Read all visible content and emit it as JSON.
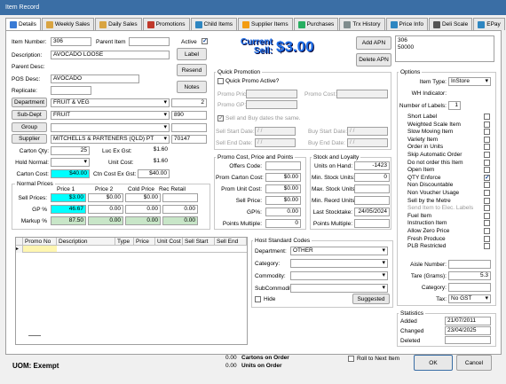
{
  "window": {
    "title": "Item Record"
  },
  "tabs": [
    {
      "label": "Details",
      "color": "#3a7bd5"
    },
    {
      "label": "Weekly Sales",
      "color": "#d9a441"
    },
    {
      "label": "Daily Sales",
      "color": "#d9a441"
    },
    {
      "label": "Promotions",
      "color": "#c0392b"
    },
    {
      "label": "Child Items",
      "color": "#2e86c1"
    },
    {
      "label": "Supplier Items",
      "color": "#f39c12"
    },
    {
      "label": "Purchases",
      "color": "#27ae60"
    },
    {
      "label": "Trx History",
      "color": "#7f8c8d"
    },
    {
      "label": "Price Info",
      "color": "#2e86c1"
    },
    {
      "label": "Deli Scale",
      "color": "#555555"
    },
    {
      "label": "EPay",
      "color": "#2e86c1"
    }
  ],
  "item": {
    "item_number_label": "Item Number:",
    "item_number": "306",
    "parent_item_label": "Parent Item",
    "parent_item": "",
    "active_label": "Active",
    "description_label": "Description:",
    "description": "AVOCADO  LOOSE",
    "parent_desc_label": "Parent Desc:",
    "pos_desc_label": "POS Desc:",
    "pos_desc": "AVOCADO",
    "replicate_label": "Replicate:",
    "label_btn": "Label",
    "resend_btn": "Resend",
    "notes_btn": "Notes",
    "current_sell_line1": "Current",
    "current_sell_line2": "Sell:",
    "current_sell_value": "$3.00",
    "add_apn_btn": "Add APN",
    "delete_apn_btn": "Delete APN",
    "apns": [
      "306",
      "50000"
    ]
  },
  "classification": {
    "department_btn": "Department",
    "department": "FRUIT & VEG",
    "department_code": "2",
    "subdept_btn": "Sub-Dept",
    "subdept": "FRUIT",
    "subdept_code": "890",
    "group_btn": "Group",
    "group": "",
    "supplier_btn": "Supplier",
    "supplier": "MITCHELLS & PARTENERS (QLD) PT",
    "supplier_code": "70147"
  },
  "costs": {
    "carton_qty_label": "Carton Qty:",
    "carton_qty": "25",
    "luc_label": "Luc Ex Gst:",
    "luc": "$1.60",
    "hold_normal_label": "Hold Normal:",
    "unit_cost_label": "Unit Cost:",
    "unit_cost": "$1.60",
    "carton_cost_label": "Carton Cost:",
    "carton_cost": "$40.00",
    "ctn_cost_label": "Ctn Cost Ex Gst:",
    "ctn_cost": "$40.00"
  },
  "normal_prices": {
    "title": "Normal Prices",
    "headers": [
      "Price 1",
      "Price 2",
      "Cold Price",
      "Rec Retail"
    ],
    "rows": [
      {
        "label": "Sell Prices:",
        "values": [
          "$3.00",
          "$0.00",
          "$0.00",
          ""
        ]
      },
      {
        "label": "GP %",
        "values": [
          "46.67",
          "0.00",
          "0.00",
          "0.00"
        ]
      },
      {
        "label": "Markup %",
        "values": [
          "87.50",
          "0.00",
          "0.00",
          "0.00"
        ]
      }
    ]
  },
  "quick_promo": {
    "title": "Quick Promotion",
    "active_label": "Quick Promo Active?",
    "promo_price_label": "Promo Price:",
    "promo_cost_label": "Promo Cost:",
    "promo_gp_label": "Promo GP:",
    "same_dates_label": "Sell and Buy dates the same.",
    "sell_start_label": "Sell Start Date:",
    "sell_start": "/ /",
    "buy_start_label": "Buy Start Date:",
    "buy_start": "/ /",
    "sell_end_label": "Sell End Date:",
    "sell_end": "/ /",
    "buy_end_label": "Buy End Date:",
    "buy_end": "/ /"
  },
  "promo_cost": {
    "title": "Promo Cost, Price and Points",
    "rows": [
      {
        "label": "Offers Code:",
        "value": ""
      },
      {
        "label": "Prom Carton Cost:",
        "value": "$0.00"
      },
      {
        "label": "Prom Unit Cost:",
        "value": "$0.00"
      },
      {
        "label": "Sell Price:",
        "value": "$0.00"
      },
      {
        "label": "GP%:",
        "value": "0.00"
      },
      {
        "label": "Points Multiple:",
        "value": "0"
      }
    ]
  },
  "stock": {
    "title": "Stock and Loyalty",
    "rows": [
      {
        "label": "Units on Hand:",
        "value": "-1423"
      },
      {
        "label": "Min. Stock Units:",
        "value": "0"
      },
      {
        "label": "Max. Stock Units:",
        "value": ""
      },
      {
        "label": "Min. Reord Units:",
        "value": ""
      },
      {
        "label": "Last Stocktake:",
        "value": "24/05/2024"
      },
      {
        "label": "Points Multiple:",
        "value": ""
      }
    ]
  },
  "promo_grid": {
    "headers": [
      "Promo No",
      "Description",
      "Type",
      "Price",
      "Unit Cost",
      "Sell Start",
      "Sell End"
    ]
  },
  "host_codes": {
    "title": "Host Standard Codes",
    "department_label": "Department:",
    "department": "OTHER",
    "category_label": "Category:",
    "commodity_label": "Commodity:",
    "subcommodity_label": "SubCommodity:",
    "hide_label": "Hide",
    "suggested_btn": "Suggested"
  },
  "options": {
    "title": "Options",
    "item_type_label": "Item Type:",
    "item_type": "InStore",
    "wh_indicator_label": "WH Indicator:",
    "num_labels_label": "Number of Labels:",
    "num_labels": "1",
    "flags": [
      {
        "label": "Short Label",
        "checked": false
      },
      {
        "label": "Weighted Scale Item",
        "checked": false
      },
      {
        "label": "Slow Moving Item",
        "checked": false
      },
      {
        "label": "Variety Item",
        "checked": false
      },
      {
        "label": "Order in Units",
        "checked": false
      },
      {
        "label": "Skip Automatic Order",
        "checked": false
      },
      {
        "label": "Do not order this Item",
        "checked": false
      },
      {
        "label": "Open Item",
        "checked": false
      },
      {
        "label": "QTY Enforce",
        "checked": true
      },
      {
        "label": "Non Discountable",
        "checked": false
      },
      {
        "label": "Non Voucher Usage",
        "checked": false
      },
      {
        "label": "Sell by the Metre",
        "checked": false
      },
      {
        "label": "Send Item to Elec. Labels",
        "checked": false,
        "disabled": true
      },
      {
        "label": "Fuel Item",
        "checked": false
      },
      {
        "label": "Instruction Item",
        "checked": false
      },
      {
        "label": "Allow Zero Price",
        "checked": false
      },
      {
        "label": "Fresh Produce",
        "checked": false
      },
      {
        "label": "PLB Restricted",
        "checked": false
      }
    ],
    "aisle_label": "Aisle Number:",
    "aisle": "",
    "tare_label": "Tare (Grams):",
    "tare": "5.3",
    "category_label": "Category:",
    "category": "",
    "tax_label": "Tax:",
    "tax": "No GST"
  },
  "statistics": {
    "title": "Statistics",
    "added_label": "Added",
    "added": "21/07/2011",
    "changed_label": "Changed",
    "changed": "23/04/2025",
    "deleted_label": "Deleted",
    "deleted": ""
  },
  "footer": {
    "uom": "UOM:  Exempt",
    "cartons_value": "0.00",
    "cartons_label": "Cartons on Order",
    "units_value": "0.00",
    "units_label": "Units on Order",
    "roll_label": "Roll to Next Item",
    "ok_btn": "OK",
    "cancel_btn": "Cancel"
  }
}
